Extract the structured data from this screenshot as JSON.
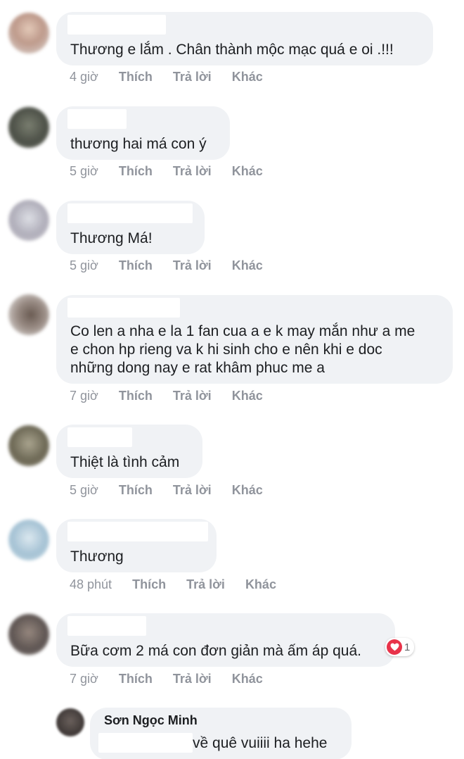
{
  "comments": [
    {
      "text": "Thương e lắm . Chân thành mộc mạc quá e oi .!!!",
      "time": "4 giờ",
      "like": "Thích",
      "reply": "Trả lời",
      "more": "Khác"
    },
    {
      "text": "thương hai má con ý",
      "time": "5 giờ",
      "like": "Thích",
      "reply": "Trả lời",
      "more": "Khác"
    },
    {
      "text": "Thương Má!",
      "time": "5 giờ",
      "like": "Thích",
      "reply": "Trả lời",
      "more": "Khác"
    },
    {
      "text_lines": [
        "Co len a nha e la 1 fan cua a e k may mắn như a me",
        "e chon hp rieng va k hi sinh cho e nên khi e doc",
        "những dong nay e rat khâm phuc me a"
      ],
      "time": "7 giờ",
      "like": "Thích",
      "reply": "Trả lời",
      "more": "Khác"
    },
    {
      "text": "Thiệt là tình cảm",
      "time": "5 giờ",
      "like": "Thích",
      "reply": "Trả lời",
      "more": "Khác"
    },
    {
      "text": "Thương",
      "time": "48 phút",
      "like": "Thích",
      "reply": "Trả lời",
      "more": "Khác"
    },
    {
      "text": "Bữa cơm 2 má con đơn giản mà ấm áp quá.",
      "time": "7 giờ",
      "like": "Thích",
      "reply": "Trả lời",
      "more": "Khác",
      "reaction_count": "1",
      "reaction_icon": "heart-icon",
      "reaction_color": "#e8334a"
    }
  ],
  "reply": {
    "author": "Sơn Ngọc Minh",
    "text": "về quê vuiiii ha hehe"
  },
  "colors": {
    "bubble": "#f0f2f5",
    "meta": "#90949c",
    "text": "#1c1e21"
  }
}
